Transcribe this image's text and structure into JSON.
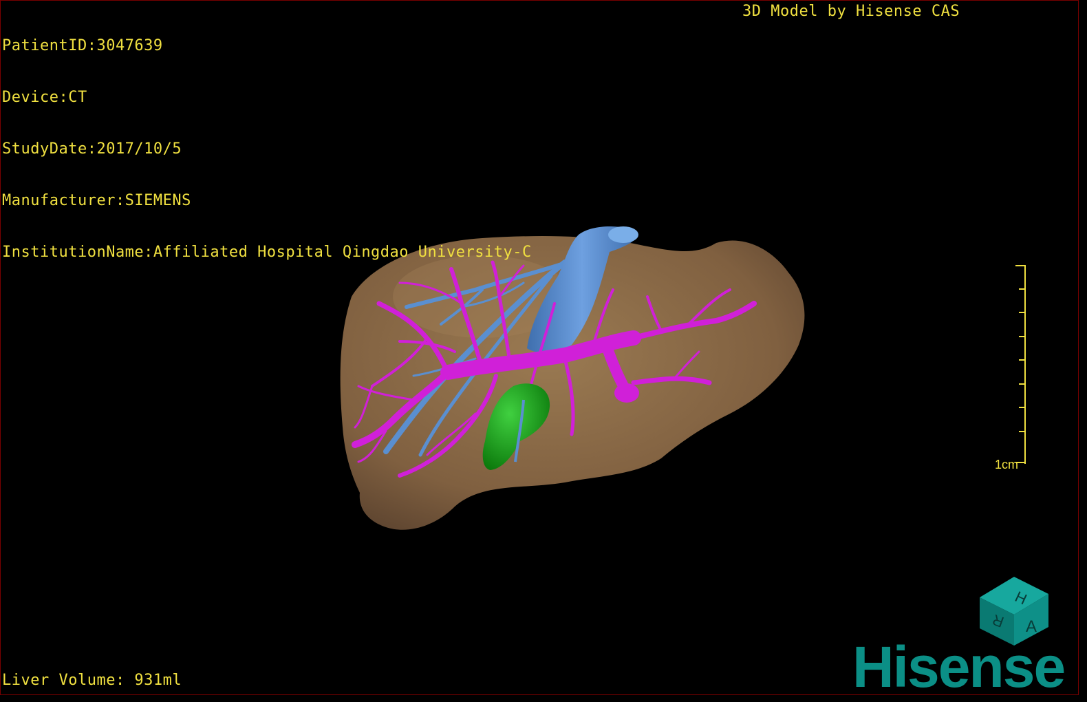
{
  "overlay": {
    "patient_id": "PatientID:3047639",
    "device": "Device:CT",
    "study_date": "StudyDate:2017/10/5",
    "manufacturer": "Manufacturer:SIEMENS",
    "institution": "InstitutionName:Affiliated Hospital Qingdao University-C",
    "model_credit": "3D Model by Hisense CAS",
    "liver_volume": "Liver Volume: 931ml"
  },
  "scale_bar": {
    "label": "1cm"
  },
  "orientation_cube": {
    "faces": [
      "H",
      "R",
      "A"
    ]
  },
  "brand": {
    "logo_text": "Hisense"
  },
  "colors": {
    "overlay_text": "#f0e040",
    "liver": "#8a6a45",
    "portal_vein": "#d020d8",
    "hepatic_vein": "#5a8fd0",
    "gallbladder": "#1fa01f",
    "cube": "#0b8f86",
    "viewport_border": "#7a0000"
  },
  "structures": [
    "liver",
    "portal-vein",
    "hepatic-vein",
    "gallbladder"
  ]
}
